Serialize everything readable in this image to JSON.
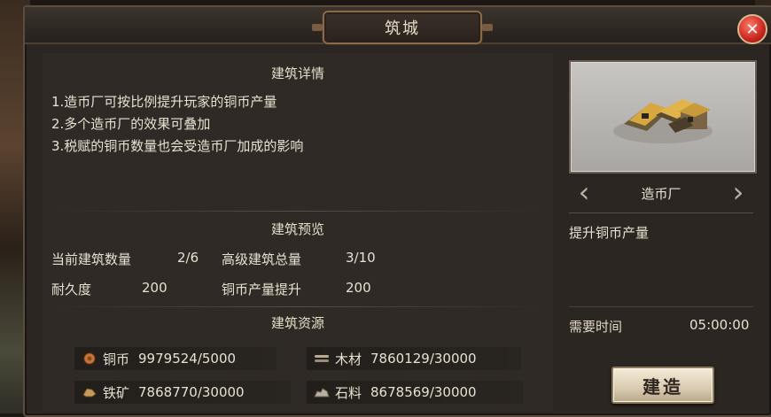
{
  "window": {
    "title": "筑城"
  },
  "details": {
    "section_title": "建筑详情",
    "lines": [
      "1.造币厂可按比例提升玩家的铜币产量",
      "2.多个造币厂的效果可叠加",
      "3.税赋的铜币数量也会受造币厂加成的影响"
    ]
  },
  "preview": {
    "section_title": "建筑预览",
    "current_count_label": "当前建筑数量",
    "current_count_value": "2/6",
    "advanced_total_label": "高级建筑总量",
    "advanced_total_value": "3/10",
    "durability_label": "耐久度",
    "durability_value": "200",
    "copper_boost_label": "铜币产量提升",
    "copper_boost_value": "200"
  },
  "resources": {
    "section_title": "建筑资源",
    "items": [
      {
        "name": "铜币",
        "value": "9979524/5000",
        "icon": "coin-icon"
      },
      {
        "name": "木材",
        "value": "7860129/30000",
        "icon": "wood-icon"
      },
      {
        "name": "铁矿",
        "value": "7868770/30000",
        "icon": "iron-ore-icon"
      },
      {
        "name": "石料",
        "value": "8678569/30000",
        "icon": "stone-icon"
      }
    ]
  },
  "building": {
    "name": "造币厂",
    "effect": "提升铜币产量",
    "time_label": "需要时间",
    "time_value": "05:00:00",
    "build_label": "建造"
  },
  "colors": {
    "panel_bg": "#2f2a25",
    "text": "#e8e0d0",
    "close_red": "#c8261e",
    "button_face": "#e8dcc4"
  }
}
